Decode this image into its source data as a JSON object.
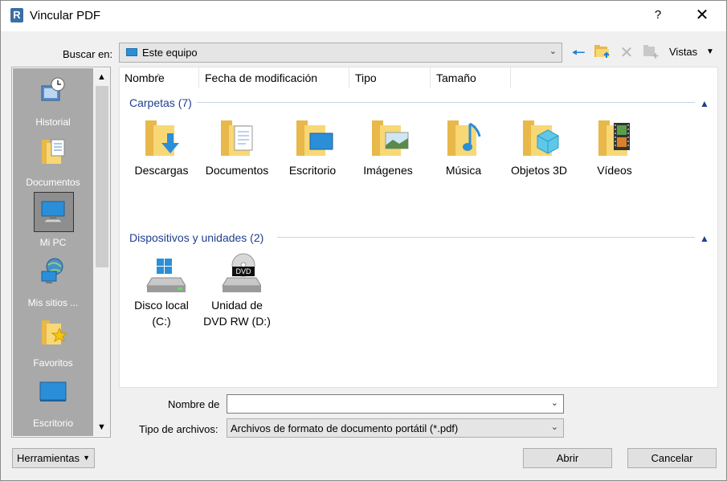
{
  "window": {
    "title": "Vincular PDF",
    "help": "?",
    "close": "✕",
    "app_icon_letter": "R"
  },
  "lookin": {
    "label": "Buscar en:",
    "value": "Este equipo"
  },
  "toolbar": {
    "views_label": "Vistas"
  },
  "places": [
    {
      "label": "Historial",
      "icon": "history-icon"
    },
    {
      "label": "Documentos",
      "icon": "documents-icon"
    },
    {
      "label": "Mi PC",
      "icon": "computer-icon",
      "selected": true
    },
    {
      "label": "Mis sitios ...",
      "icon": "network-sites-icon"
    },
    {
      "label": "Favoritos",
      "icon": "favorites-icon"
    },
    {
      "label": "Escritorio",
      "icon": "desktop-icon"
    }
  ],
  "columns": [
    "Nombre",
    "Fecha de modificación",
    "Tipo",
    "Tamaño"
  ],
  "groups": {
    "folders": {
      "title": "Carpetas (7)",
      "items": [
        "Descargas",
        "Documentos",
        "Escritorio",
        "Imágenes",
        "Música",
        "Objetos 3D",
        "Vídeos"
      ]
    },
    "devices": {
      "title": "Dispositivos y unidades (2)",
      "items": [
        {
          "line1": "Disco local",
          "line2": "(C:)"
        },
        {
          "line1": "Unidad de",
          "line2": "DVD RW (D:)"
        }
      ]
    }
  },
  "filename": {
    "label": "Nombre de",
    "value": ""
  },
  "filetype": {
    "label": "Tipo de archivos:",
    "value": "Archivos de formato de documento portátil  (*.pdf)"
  },
  "buttons": {
    "tools": "Herramientas",
    "open": "Abrir",
    "cancel": "Cancelar"
  },
  "colors": {
    "accent": "#1e7fd8",
    "group_text": "#1f3f8f",
    "places_bg": "#a9a9a9"
  }
}
